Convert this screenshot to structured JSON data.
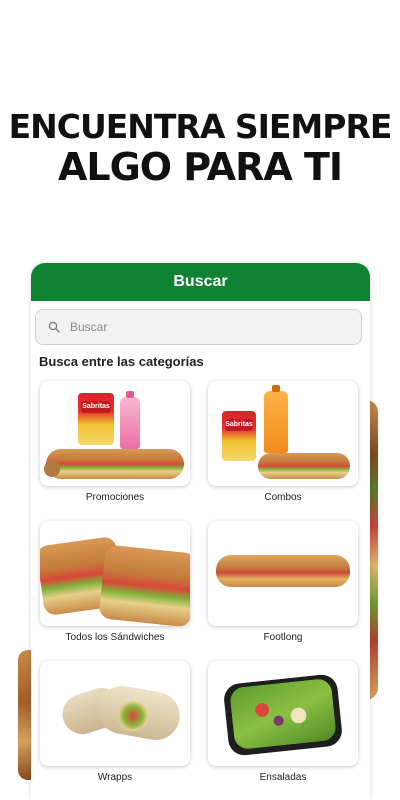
{
  "headline": {
    "line1": "ENCUENTRA SIEMPRE",
    "line2": "ALGO PARA TI"
  },
  "app": {
    "title": "Buscar",
    "search": {
      "placeholder": "Buscar",
      "value": ""
    },
    "section_title": "Busca entre las categorías",
    "categories": [
      {
        "label": "Promociones",
        "icon": "promo-combo-image"
      },
      {
        "label": "Combos",
        "icon": "combo-image"
      },
      {
        "label": "Todos los Sándwiches",
        "icon": "sandwiches-image"
      },
      {
        "label": "Footlong",
        "icon": "footlong-image"
      },
      {
        "label": "Wrapps",
        "icon": "wrap-image"
      },
      {
        "label": "Ensaladas",
        "icon": "salad-image"
      }
    ],
    "colors": {
      "brand_green": "#0f8233",
      "headline": "#111111"
    },
    "bag_text": "Sabritas"
  }
}
